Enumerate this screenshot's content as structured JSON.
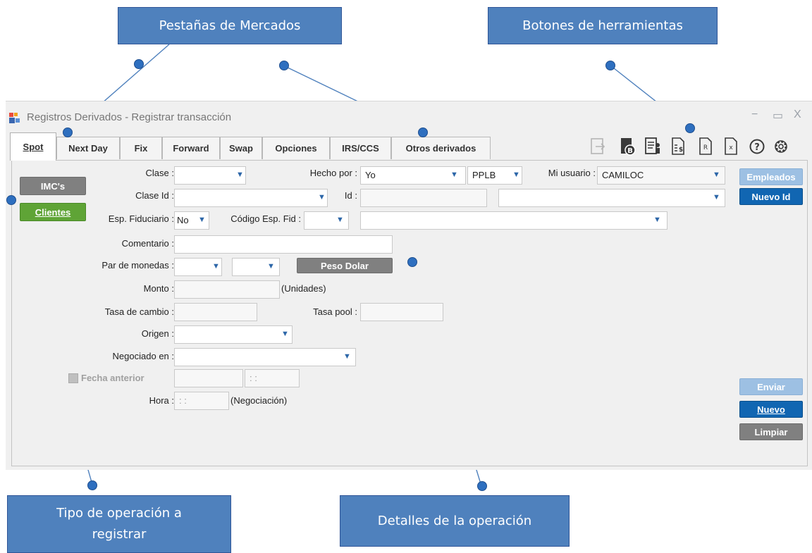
{
  "annotations": {
    "tabs_callout": "Pestañas de Mercados",
    "tools_callout": "Botones de herramientas",
    "type_callout_line1": "Tipo de operación a",
    "type_callout_line2": "registrar",
    "details_callout": "Detalles de la operación"
  },
  "window": {
    "title": "Registros Derivados - Registrar transacción",
    "minimize": "−",
    "maximize": "▭",
    "close": "X"
  },
  "tabs": [
    {
      "label": "Spot",
      "active": true
    },
    {
      "label": "Next Day"
    },
    {
      "label": "Fix"
    },
    {
      "label": "Forward"
    },
    {
      "label": "Swap"
    },
    {
      "label": "Opciones"
    },
    {
      "label": "IRS/CCS"
    },
    {
      "label": "Otros derivados"
    }
  ],
  "toolbar": [
    "share-doc-icon",
    "document-b-icon",
    "document-person-icon",
    "document-dollar-icon",
    "document-r-icon",
    "document-x-icon",
    "help-icon",
    "settings-icon"
  ],
  "left_buttons": {
    "imcs": "IMC's",
    "clientes": "Clientes"
  },
  "form": {
    "clase_label": "Clase :",
    "hecho_por_label": "Hecho por :",
    "hecho_por_value": "Yo",
    "pplb_value": "PPLB",
    "mi_usuario_label": "Mi usuario :",
    "mi_usuario_value": "CAMILOC",
    "clase_id_label": "Clase Id :",
    "id_label": "Id :",
    "esp_fiduciario_label": "Esp. Fiduciario :",
    "esp_fiduciario_value": "No",
    "codigo_esp_fid_label": "Código Esp. Fid :",
    "comentario_label": "Comentario :",
    "par_monedas_label": "Par de monedas :",
    "peso_dolar_button": "Peso Dolar",
    "monto_label": "Monto :",
    "unidades_label": "(Unidades)",
    "tasa_cambio_label": "Tasa de cambio :",
    "tasa_pool_label": "Tasa pool :",
    "origen_label": "Origen :",
    "negociado_label": "Negociado en :",
    "fecha_anterior_label": "Fecha anterior",
    "fecha_time_placeholder": ": :",
    "hora_label": "Hora :",
    "hora_value": ": :",
    "negociacion_label": "(Negociación)"
  },
  "right_buttons": {
    "empleados": "Empleados",
    "nuevo_id": "Nuevo Id",
    "enviar": "Enviar",
    "nuevo": "Nuevo",
    "limpiar": "Limpiar"
  },
  "colors": {
    "callout": "#4f81bd",
    "primary_button": "#1166b2",
    "green_button": "#5fa436",
    "gray_button": "#808080"
  }
}
